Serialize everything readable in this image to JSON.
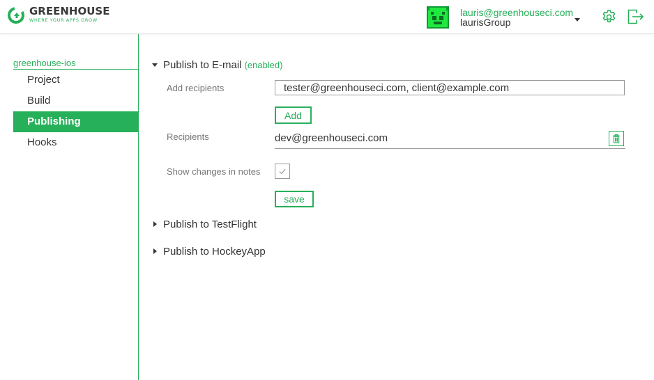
{
  "header": {
    "logo_name": "GREENHOUSE",
    "logo_tagline": "WHERE YOUR APPS GROW",
    "user_email": "lauris@greenhouseci.com",
    "user_group": "laurisGroup"
  },
  "sidebar": {
    "project": "greenhouse-ios",
    "items": [
      {
        "label": "Project",
        "active": false
      },
      {
        "label": "Build",
        "active": false
      },
      {
        "label": "Publishing",
        "active": true
      },
      {
        "label": "Hooks",
        "active": false
      }
    ]
  },
  "email": {
    "title": "Publish to E-mail",
    "status": "(enabled)",
    "add_recipients_label": "Add recipients",
    "add_recipients_value": "tester@greenhouseci.com, client@example.com",
    "add_button": "Add",
    "recipients_label": "Recipients",
    "recipients": [
      "dev@greenhouseci.com"
    ],
    "show_changes_label": "Show changes in notes",
    "show_changes_checked": true,
    "save_button": "save"
  },
  "sections": [
    {
      "title": "Publish to TestFlight",
      "expanded": false
    },
    {
      "title": "Publish to HockeyApp",
      "expanded": false
    }
  ],
  "colors": {
    "accent": "#27b05a",
    "text": "#333333",
    "muted": "#777777"
  },
  "icons": [
    "greenhouse-logo-icon",
    "avatar-icon",
    "chevron-down-icon",
    "gear-icon",
    "logout-icon",
    "trash-icon",
    "checkmark-icon"
  ]
}
